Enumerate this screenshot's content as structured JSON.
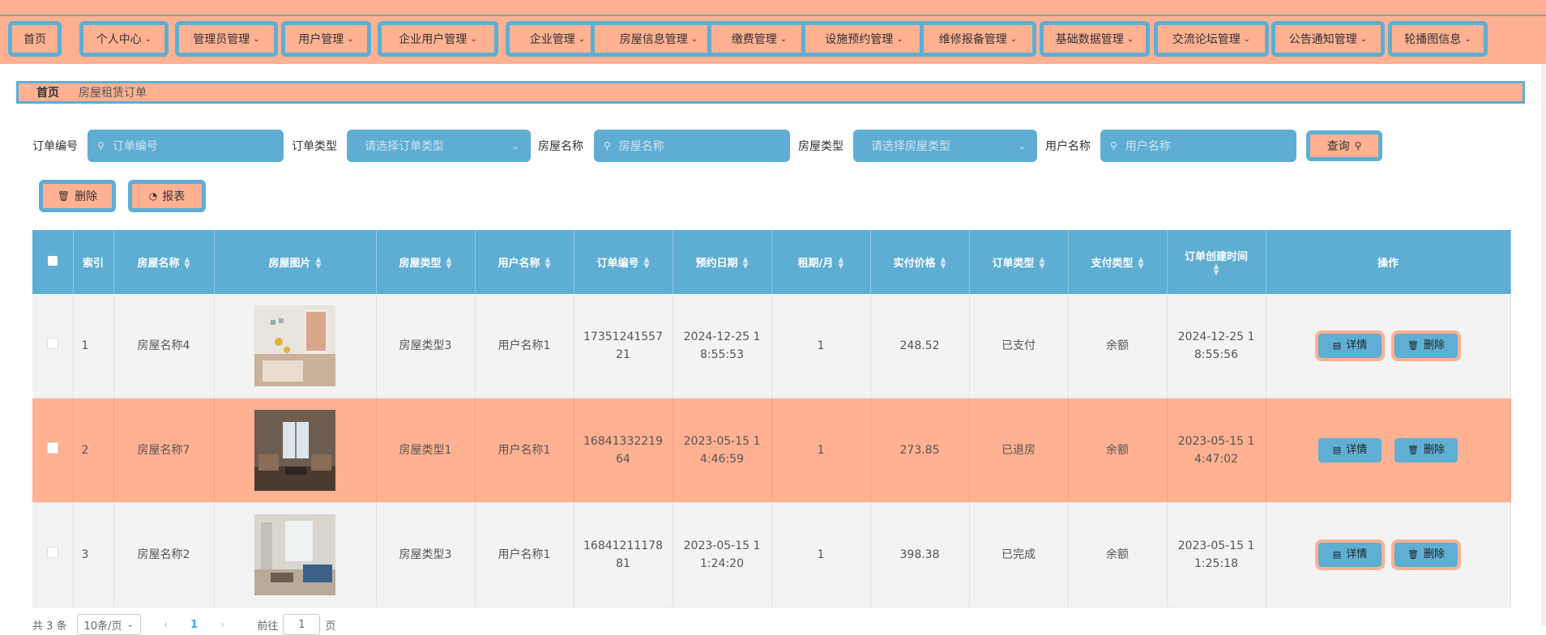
{
  "nav": [
    {
      "label": "首页",
      "has_menu": false
    },
    {
      "label": "个人中心",
      "has_menu": true
    },
    {
      "label": "管理员管理",
      "has_menu": true
    },
    {
      "label": "用户管理",
      "has_menu": true
    },
    {
      "label": "企业用户管理",
      "has_menu": true
    },
    {
      "label": "企业管理",
      "has_menu": true
    },
    {
      "label": "房屋信息管理",
      "has_menu": true
    },
    {
      "label": "缴费管理",
      "has_menu": true
    },
    {
      "label": "设施预约管理",
      "has_menu": true
    },
    {
      "label": "维修报备管理",
      "has_menu": true
    },
    {
      "label": "基础数据管理",
      "has_menu": true
    },
    {
      "label": "交流论坛管理",
      "has_menu": true
    },
    {
      "label": "公告通知管理",
      "has_menu": true
    },
    {
      "label": "轮播图信息",
      "has_menu": true
    }
  ],
  "breadcrumb": {
    "home": "首页",
    "current": "房屋租赁订单"
  },
  "search": {
    "order_no_label": "订单编号",
    "order_no_placeholder": "订单编号",
    "order_type_label": "订单类型",
    "order_type_placeholder": "请选择订单类型",
    "house_name_label": "房屋名称",
    "house_name_placeholder": "房屋名称",
    "house_type_label": "房屋类型",
    "house_type_placeholder": "请选择房屋类型",
    "user_name_label": "用户名称",
    "user_name_placeholder": "用户名称",
    "query_label": "查询"
  },
  "actions": {
    "delete_label": "删除",
    "report_label": "报表"
  },
  "table": {
    "headers": {
      "index": "索引",
      "house_name": "房屋名称",
      "house_image": "房屋图片",
      "house_type": "房屋类型",
      "user_name": "用户名称",
      "order_no": "订单编号",
      "booking_date": "预约日期",
      "lease_term": "租期/月",
      "price": "实付价格",
      "order_type": "订单类型",
      "pay_type": "支付类型",
      "created": "订单创建时间",
      "ops": "操作"
    },
    "rows": [
      {
        "index": "1",
        "house_name": "房屋名称4",
        "house_type": "房屋类型3",
        "user_name": "用户名称1",
        "order_no": "1735124155721",
        "booking_date": "2024-12-25 18:55:53",
        "lease_term": "1",
        "price": "248.52",
        "order_type": "已支付",
        "pay_type": "余额",
        "created": "2024-12-25 18:55:56",
        "photo": "bright-room"
      },
      {
        "index": "2",
        "house_name": "房屋名称7",
        "house_type": "房屋类型1",
        "user_name": "用户名称1",
        "order_no": "1684133221964",
        "booking_date": "2023-05-15 14:46:59",
        "lease_term": "1",
        "price": "273.85",
        "order_type": "已退房",
        "pay_type": "余额",
        "created": "2023-05-15 14:47:02",
        "photo": "window-room"
      },
      {
        "index": "3",
        "house_name": "房屋名称2",
        "house_type": "房屋类型3",
        "user_name": "用户名称1",
        "order_no": "1684121117881",
        "booking_date": "2023-05-15 11:24:20",
        "lease_term": "1",
        "price": "398.38",
        "order_type": "已完成",
        "pay_type": "余额",
        "created": "2023-05-15 11:25:18",
        "photo": "sofa-room"
      }
    ],
    "detail_label": "详情",
    "delete_label": "删除"
  },
  "pager": {
    "total": "共 3 条",
    "page_size": "10条/页",
    "current": "1",
    "goto": "前往",
    "page_value": "1",
    "unit": "页"
  }
}
